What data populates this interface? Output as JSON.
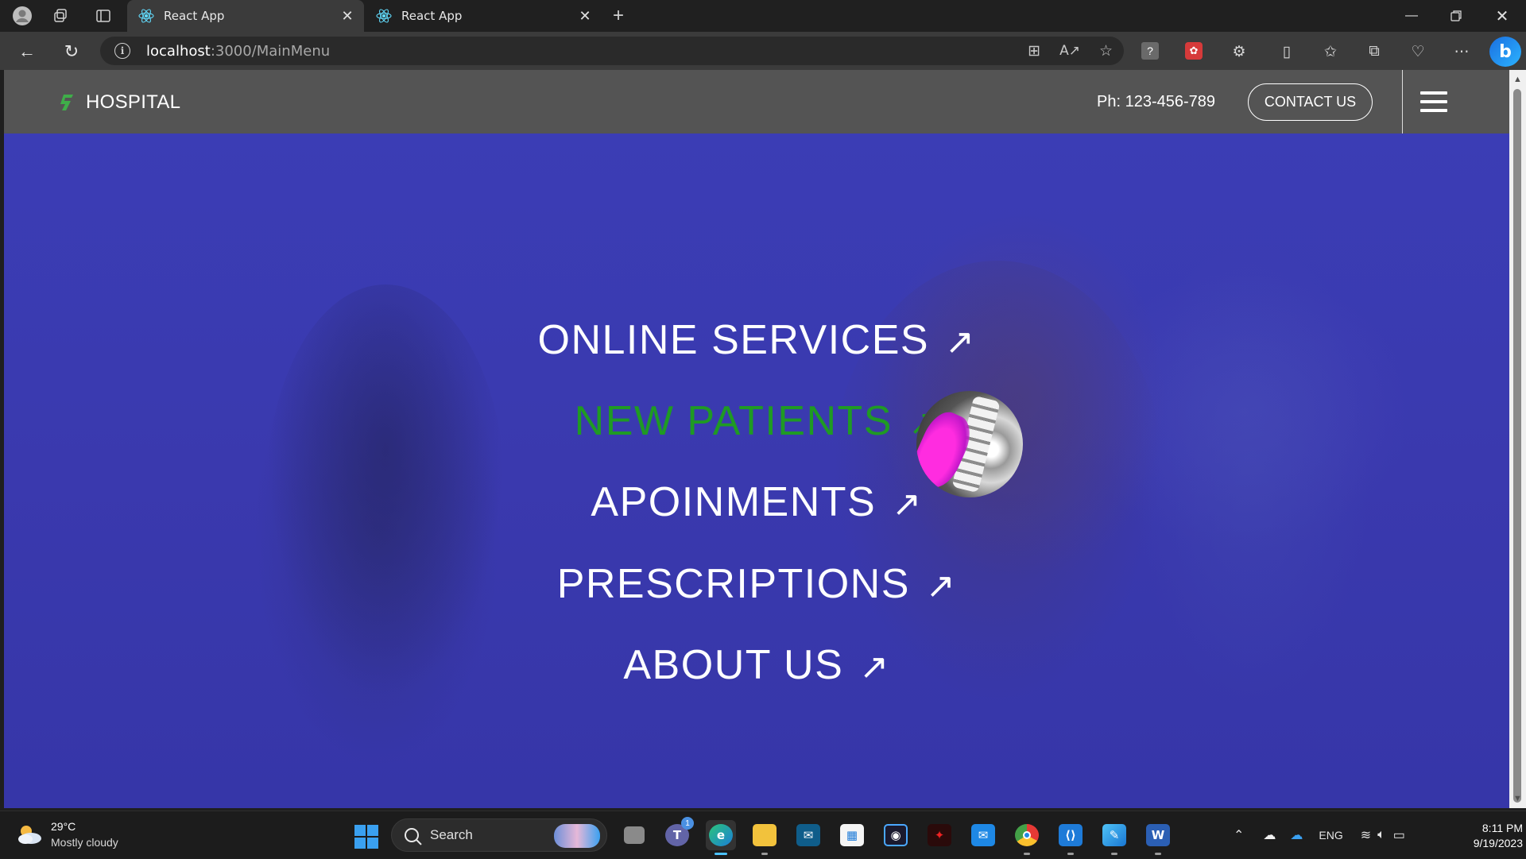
{
  "browser": {
    "tabs": [
      {
        "title": "React App",
        "active": true
      },
      {
        "title": "React App",
        "active": false
      }
    ],
    "url_host": "localhost",
    "url_rest": ":3000/MainMenu"
  },
  "site": {
    "logo_text": "HOSPITAL",
    "phone": "Ph: 123-456-789",
    "contact_label": "CONTACT US",
    "accent_color": "#1f9a24",
    "header_color": "#545454",
    "overlay_color": "#3a3ab0"
  },
  "menu": {
    "items": [
      {
        "label": "ONLINE SERVICES",
        "arrow": "↗"
      },
      {
        "label": "NEW PATIENTS",
        "arrow": "↗",
        "hovered": true
      },
      {
        "label": "APOINMENTS",
        "arrow": "↗"
      },
      {
        "label": "PRESCRIPTIONS",
        "arrow": "↗"
      },
      {
        "label": "ABOUT US",
        "arrow": "↗"
      }
    ]
  },
  "taskbar": {
    "weather_temp": "29°C",
    "weather_desc": "Mostly cloudy",
    "search_label": "Search",
    "teams_badge": "1",
    "word_label": "W",
    "language": "ENG",
    "time": "8:11 PM",
    "date": "9/19/2023"
  },
  "icons": [
    "profile-icon",
    "workspaces-icon",
    "tab-actions-icon",
    "react-icon",
    "close-icon",
    "new-tab-icon",
    "minimize-icon",
    "restore-icon",
    "back-icon",
    "refresh-icon",
    "info-icon",
    "read-aloud-icon",
    "favorite-star-icon",
    "extensions-icon",
    "split-screen-icon",
    "favorites-icon",
    "collections-icon",
    "health-icon",
    "more-icon",
    "bing-icon",
    "hamburger-icon",
    "weather-icon",
    "windows-start-icon",
    "search-icon"
  ]
}
